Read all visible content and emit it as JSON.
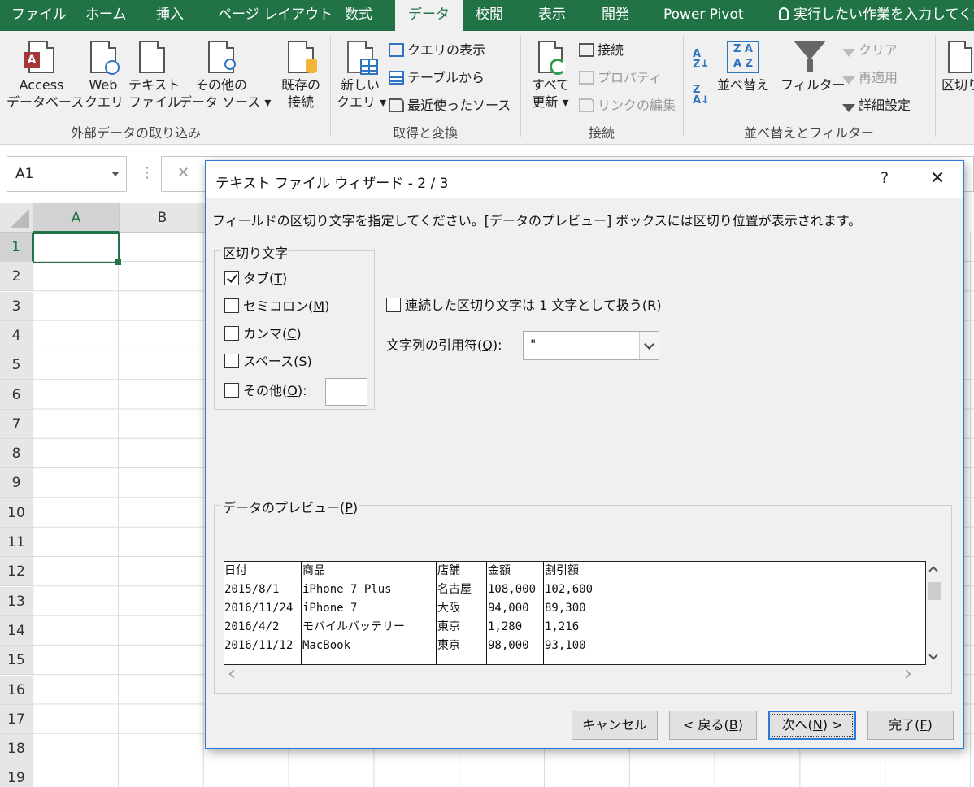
{
  "ribbon": {
    "tabs": [
      "ファイル",
      "ホーム",
      "挿入",
      "ページ レイアウト",
      "数式",
      "データ",
      "校閲",
      "表示",
      "開発",
      "Power Pivot"
    ],
    "active_tab": "データ",
    "tell_me": "実行したい作業を入力してくださ",
    "external_data": {
      "access_line1": "Access",
      "access_line2": "データベース",
      "web_line1": "Web",
      "web_line2": "クエリ",
      "text_line1": "テキスト",
      "text_line2": "ファイル",
      "other_line1": "その他の",
      "other_line2": "データ ソース",
      "existing_line1": "既存の",
      "existing_line2": "接続",
      "group_label": "外部データの取り込み"
    },
    "get_transform": {
      "new_query_line1": "新しい",
      "new_query_line2": "クエリ",
      "show_queries": "クエリの表示",
      "from_table": "テーブルから",
      "recent_sources": "最近使ったソース",
      "group_label": "取得と変換"
    },
    "connections": {
      "refresh_line1": "すべて",
      "refresh_line2": "更新",
      "connections": "接続",
      "properties": "プロパティ",
      "edit_links": "リンクの編集",
      "group_label": "接続"
    },
    "sort_filter": {
      "sort": "並べ替え",
      "filter": "フィルター",
      "clear": "クリア",
      "reapply": "再適用",
      "advanced": "詳細設定",
      "group_label": "並べ替えとフィルター"
    },
    "text_to_columns": "区切り"
  },
  "namebox": {
    "value": "A1"
  },
  "grid": {
    "columns": [
      "A",
      "B"
    ],
    "rows": [
      "1",
      "2",
      "3",
      "4",
      "5",
      "6",
      "7",
      "8",
      "9",
      "10",
      "11",
      "12",
      "13",
      "14",
      "15",
      "16",
      "17",
      "18",
      "19"
    ]
  },
  "dialog": {
    "title": "テキスト ファイル ウィザード - 2 / 3",
    "help": "?",
    "close": "✕",
    "instruction": "フィールドの区切り文字を指定してください。[データのプレビュー] ボックスには区切り位置が表示されます。",
    "delimiters_legend": "区切り文字",
    "delimiters": [
      {
        "pre": "タブ(",
        "key": "T",
        "post": ")",
        "checked": true
      },
      {
        "pre": "セミコロン(",
        "key": "M",
        "post": ")",
        "checked": false
      },
      {
        "pre": "カンマ(",
        "key": "C",
        "post": ")",
        "checked": false
      },
      {
        "pre": "スペース(",
        "key": "S",
        "post": ")",
        "checked": false
      },
      {
        "pre": "その他(",
        "key": "O",
        "post": "):",
        "checked": false
      }
    ],
    "consecutive": {
      "pre": "連続した区切り文字は 1 文字として扱う(",
      "key": "R",
      "post": ")",
      "checked": false
    },
    "qualifier": {
      "pre": "文字列の引用符(",
      "key": "Q",
      "post": "):",
      "value": "\""
    },
    "preview_legend": {
      "pre": "データのプレビュー(",
      "key": "P",
      "post": ")"
    },
    "preview": {
      "headers": [
        "日付",
        "商品",
        "店舗",
        "金額",
        "割引額"
      ],
      "rows": [
        [
          "2015/8/1",
          "iPhone 7 Plus",
          "名古屋",
          "108,000",
          "102,600"
        ],
        [
          "2016/11/24",
          "iPhone 7",
          "大阪",
          "94,000",
          "89,300"
        ],
        [
          "2016/4/2",
          "モバイルバッテリー",
          "東京",
          "1,280",
          "1,216"
        ],
        [
          "2016/11/12",
          "MacBook",
          "東京",
          "98,000",
          "93,100"
        ]
      ]
    },
    "buttons": {
      "cancel": "キャンセル",
      "back_pre": "< 戻る(",
      "back_key": "B",
      "back_post": ")",
      "next_pre": "次へ(",
      "next_key": "N",
      "next_post": ") >",
      "finish_pre": "完了(",
      "finish_key": "F",
      "finish_post": ")"
    }
  },
  "colors": {
    "excel_green": "#217346",
    "dialog_border": "#2b7bd1",
    "access_red": "#a4373a"
  }
}
